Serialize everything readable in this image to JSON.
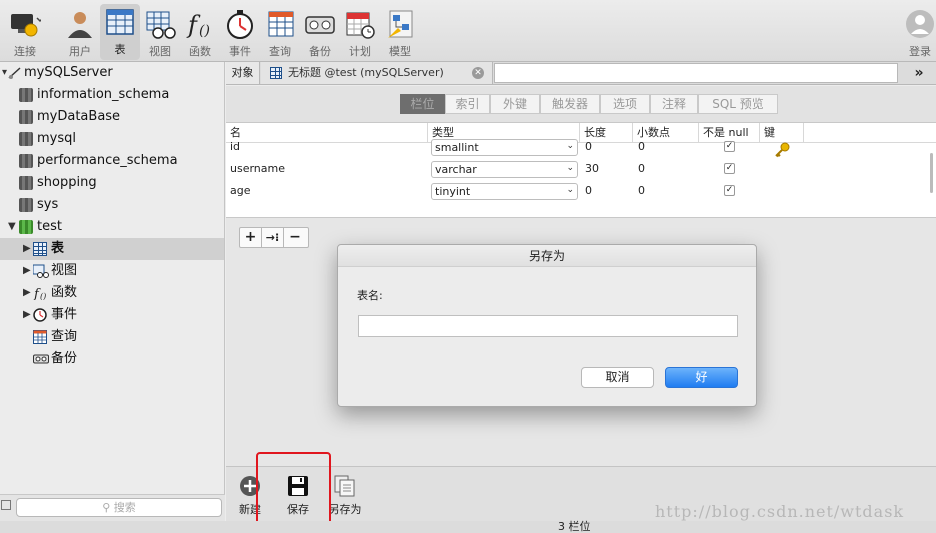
{
  "toolbar": {
    "buttons": [
      {
        "label": "连接",
        "icon": "connection-icon"
      },
      {
        "label": "用户",
        "icon": "user-icon"
      },
      {
        "label": "表",
        "icon": "table-icon"
      },
      {
        "label": "视图",
        "icon": "view-icon"
      },
      {
        "label": "函数",
        "icon": "function-icon"
      },
      {
        "label": "事件",
        "icon": "event-icon"
      },
      {
        "label": "查询",
        "icon": "query-icon"
      },
      {
        "label": "备份",
        "icon": "backup-icon"
      },
      {
        "label": "计划",
        "icon": "schedule-icon"
      },
      {
        "label": "模型",
        "icon": "model-icon"
      }
    ],
    "login_label": "登录",
    "active_index": 2
  },
  "sidebar": {
    "server": "mySQLServer",
    "databases": [
      "information_schema",
      "myDataBase",
      "mysql",
      "performance_schema",
      "shopping",
      "sys",
      "test"
    ],
    "test_children": [
      "表",
      "视图",
      "函数",
      "事件",
      "查询",
      "备份"
    ],
    "search_placeholder": "搜索"
  },
  "tabs": {
    "objects_label": "对象",
    "document_label": "无标题 @test (mySQLServer)",
    "more_label": "»"
  },
  "segments": [
    "栏位",
    "索引",
    "外键",
    "触发器",
    "选项",
    "注释",
    "SQL 预览"
  ],
  "grid": {
    "headers": [
      "名",
      "类型",
      "长度",
      "小数点",
      "不是 null",
      "键"
    ],
    "rows": [
      {
        "name": "id",
        "type": "smallint",
        "length": "0",
        "decimals": "0",
        "not_null": true
      },
      {
        "name": "username",
        "type": "varchar",
        "length": "30",
        "decimals": "0",
        "not_null": true
      },
      {
        "name": "age",
        "type": "tinyint",
        "length": "0",
        "decimals": "0",
        "not_null": true
      }
    ]
  },
  "field_buttons": [
    "+",
    "→⁝",
    "−"
  ],
  "dialog": {
    "title": "另存为",
    "field_label": "表名:",
    "input_value": "",
    "cancel_label": "取消",
    "ok_label": "好"
  },
  "bottom": {
    "new_label": "新建",
    "save_label": "保存",
    "save_as_label": "另存为"
  },
  "status": {
    "text": "3 栏位"
  },
  "watermark": "http://blog.csdn.net/wtdask",
  "colors": {
    "primary_button": "#1f7cf1",
    "highlight": "#e0161e"
  }
}
